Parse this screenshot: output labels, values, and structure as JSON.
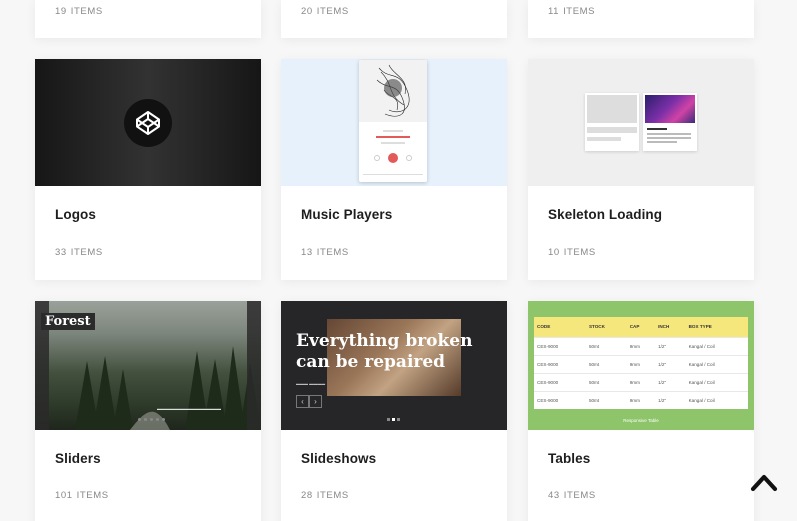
{
  "rows": [
    [
      {
        "count": "19",
        "unit": "ITEMS"
      },
      {
        "count": "20",
        "unit": "ITEMS"
      },
      {
        "count": "11",
        "unit": "ITEMS"
      }
    ],
    [
      {
        "title": "Logos",
        "count": "33",
        "unit": "ITEMS",
        "thumb": "codepen-logo"
      },
      {
        "title": "Music Players",
        "count": "13",
        "unit": "ITEMS",
        "thumb": "music-player-preview"
      },
      {
        "title": "Skeleton Loading",
        "count": "10",
        "unit": "ITEMS",
        "thumb": "skeleton-loading-preview"
      }
    ],
    [
      {
        "title": "Sliders",
        "count": "101",
        "unit": "ITEMS",
        "thumb": "forest-slider-preview"
      },
      {
        "title": "Slideshows",
        "count": "28",
        "unit": "ITEMS",
        "thumb": "slideshow-preview"
      },
      {
        "title": "Tables",
        "count": "43",
        "unit": "ITEMS",
        "thumb": "responsive-table-preview"
      }
    ]
  ],
  "thumbs": {
    "sliders": {
      "label": "Forest"
    },
    "slideshows": {
      "headline_1": "Everything broken",
      "headline_2": "can be repaired",
      "prev": "‹",
      "next": "›"
    },
    "tables": {
      "headers": [
        "CODE",
        "STOCK",
        "CAP",
        "INCH",
        "BOX TYPE"
      ],
      "rows": [
        [
          "CES-9000",
          "50mt",
          "9mm",
          "1/2\"",
          "Kangal / Coil"
        ],
        [
          "CES-9000",
          "50mt",
          "9mm",
          "1/2\"",
          "Kangal / Coil"
        ],
        [
          "CES-9000",
          "50mt",
          "9mm",
          "1/2\"",
          "Kangal / Coil"
        ],
        [
          "CES-9000",
          "50mt",
          "9mm",
          "1/2\"",
          "Kangal / Coil"
        ]
      ],
      "caption": "Responsive Table"
    }
  },
  "colors": {
    "page_bg": "#f7f7f7",
    "tables_green": "#8fc56a",
    "tables_header": "#f5e77b",
    "music_bg": "#e6f1fc",
    "music_accent": "#e25a5a"
  },
  "icons": {
    "back_to_top": "chevron-up-icon",
    "codepen": "codepen-logo-icon"
  }
}
